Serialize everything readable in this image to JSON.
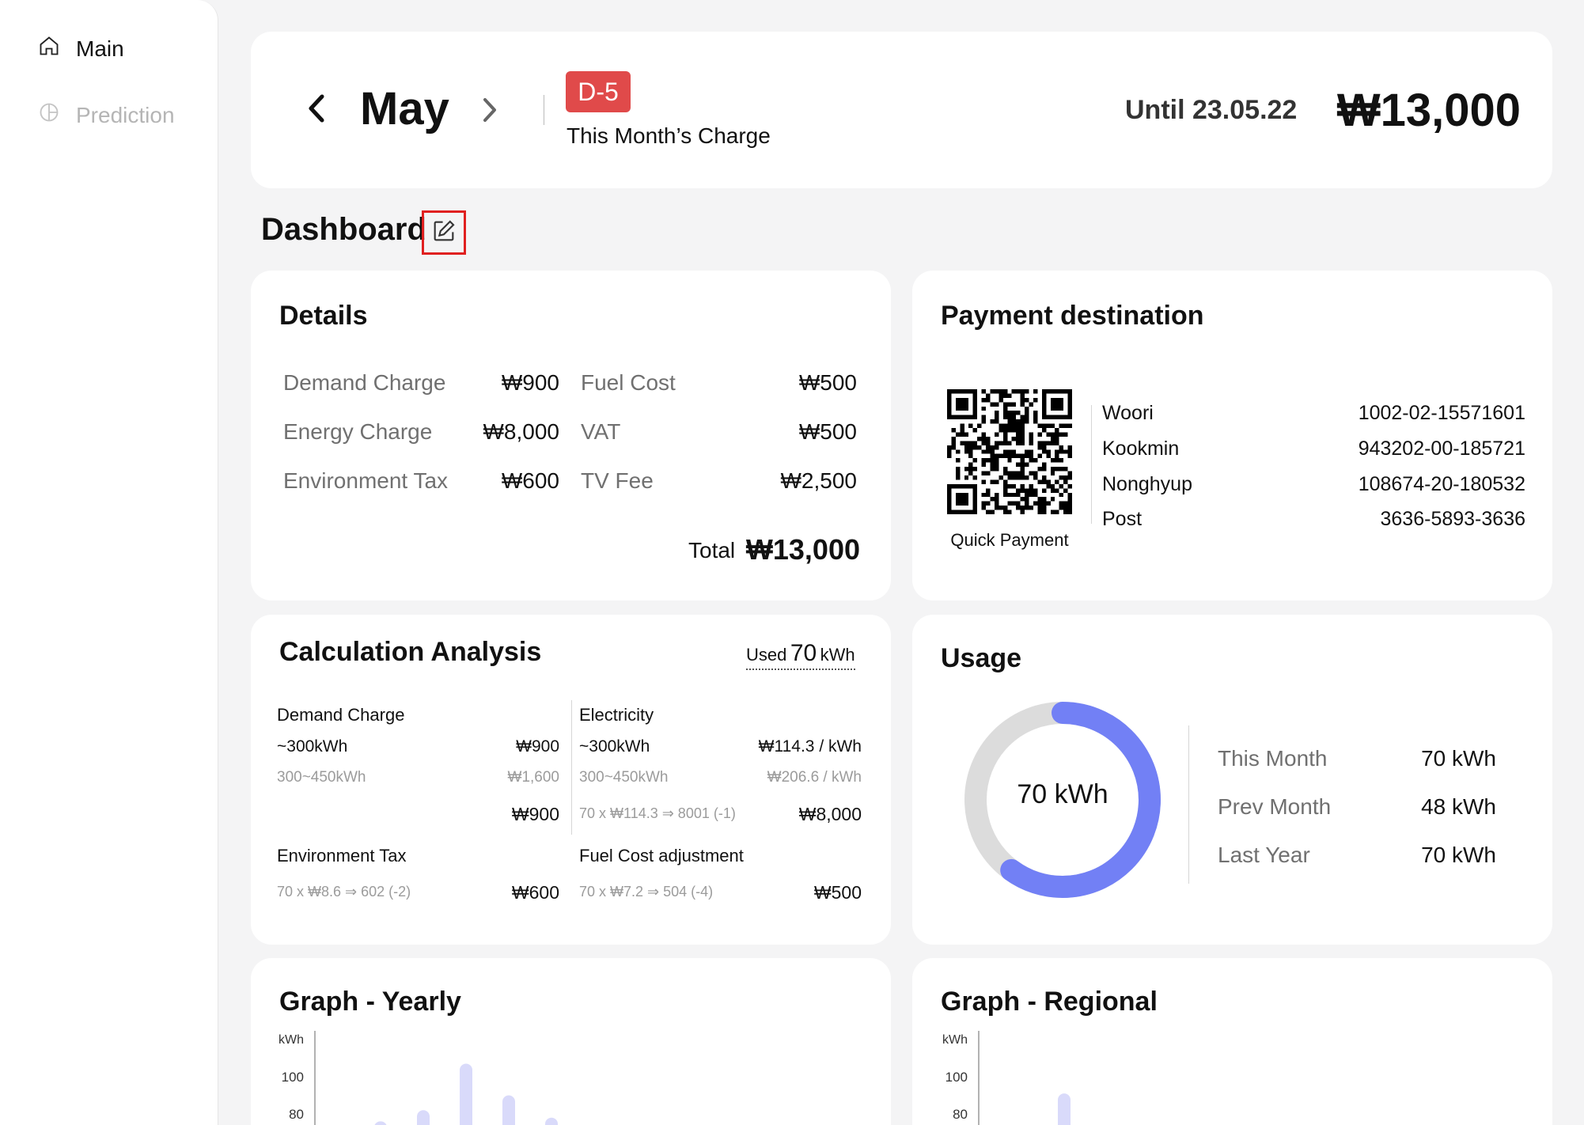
{
  "sidebar": {
    "items": [
      {
        "label": "Main",
        "icon": "home-icon",
        "active": true
      },
      {
        "label": "Prediction",
        "icon": "pie-chart-icon",
        "active": false
      }
    ]
  },
  "header": {
    "month": "May",
    "badge": "D-5",
    "subtitle": "This Month’s Charge",
    "until": "Until 23.05.22",
    "amount": "₩13,000"
  },
  "dashboard": {
    "title": "Dashboard",
    "edit_icon": "edit-icon"
  },
  "details": {
    "title": "Details",
    "rows_left": [
      {
        "label": "Demand Charge",
        "value": "₩900"
      },
      {
        "label": "Energy Charge",
        "value": "₩8,000"
      },
      {
        "label": "Environment Tax",
        "value": "₩600"
      }
    ],
    "rows_right": [
      {
        "label": "Fuel Cost",
        "value": "₩500"
      },
      {
        "label": "VAT",
        "value": "₩500"
      },
      {
        "label": "TV Fee",
        "value": "₩2,500"
      }
    ],
    "total_label": "Total",
    "total_value": "₩13,000"
  },
  "payment": {
    "title": "Payment destination",
    "qr_caption": "Quick Payment",
    "banks": [
      {
        "name": "Woori",
        "account": "1002-02-15571601"
      },
      {
        "name": "Kookmin",
        "account": "943202-00-185721"
      },
      {
        "name": "Nonghyup",
        "account": "108674-20-180532"
      },
      {
        "name": "Post",
        "account": "3636-5893-3636"
      }
    ]
  },
  "calc": {
    "title": "Calculation Analysis",
    "used_label": "Used",
    "used_value": "70",
    "used_unit": "kWh",
    "demand": {
      "title": "Demand Charge",
      "r1_label": "~300kWh",
      "r1_value": "₩900",
      "r2_label": "300~450kWh",
      "r2_value": "₩1,600",
      "total": "₩900"
    },
    "electricity": {
      "title": "Electricity",
      "r1_label": "~300kWh",
      "r1_value": "₩114.3 / kWh",
      "r2_label": "300~450kWh",
      "r2_value": "₩206.6 / kWh",
      "formula": "70 x ₩114.3 ⇒ 8001 (-1)",
      "total": "₩8,000"
    },
    "env": {
      "title": "Environment Tax",
      "formula": "70 x ₩8.6 ⇒ 602 (-2)",
      "total": "₩600"
    },
    "fuel": {
      "title": "Fuel Cost adjustment",
      "formula": "70 x ₩7.2 ⇒ 504 (-4)",
      "total": "₩500"
    }
  },
  "usage": {
    "title": "Usage",
    "center": "70 kWh",
    "progress_fraction": 0.6,
    "accent": "#7280f5",
    "track": "#dcdcdc",
    "rows": [
      {
        "label": "This Month",
        "value": "70 kWh"
      },
      {
        "label": "Prev Month",
        "value": "48 kWh"
      },
      {
        "label": "Last Year",
        "value": "70 kWh"
      }
    ]
  },
  "graph_yearly": {
    "title": "Graph - Yearly"
  },
  "graph_regional": {
    "title": "Graph - Regional"
  },
  "chart_data": [
    {
      "type": "bar",
      "title": "Graph - Yearly",
      "ylabel": "kWh",
      "yticks": [
        "100",
        "80"
      ],
      "ylim": [
        60,
        120
      ],
      "values": [
        76,
        82,
        107,
        90,
        78
      ],
      "color": "#d9dafa"
    },
    {
      "type": "bar",
      "title": "Graph - Regional",
      "ylabel": "kWh",
      "yticks": [
        "100",
        "80"
      ],
      "ylim": [
        60,
        120
      ],
      "values": [
        91
      ],
      "color": "#d9dafa"
    }
  ]
}
